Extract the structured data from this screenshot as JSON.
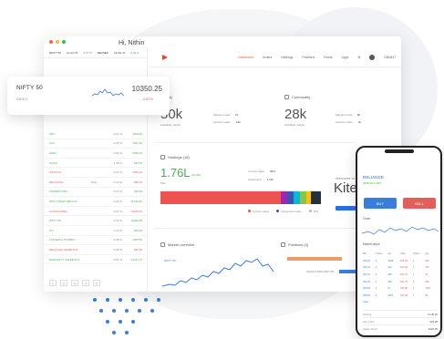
{
  "card": {
    "title": "NIFTY 50",
    "subtitle": "INDEX",
    "value": "10350.25",
    "change": "-3.57%"
  },
  "header": {
    "indices": [
      {
        "name": "NIFTY 50",
        "value": "10126.95",
        "change": "0.47 %"
      },
      {
        "name": "SENSEX",
        "value": "33399.40",
        "change": "0.40 %"
      }
    ]
  },
  "nav": {
    "items": [
      "Dashboard",
      "Orders",
      "Holdings",
      "Positions",
      "Funds",
      "Apps"
    ],
    "user": "DBA847"
  },
  "greeting": "Hi, Nithin",
  "equity": {
    "title": "Equity",
    "value": "50k",
    "sub": "Available margin",
    "rows": [
      {
        "k": "Margins used",
        "v": "10"
      },
      {
        "k": "Account value",
        "v": "10k"
      }
    ]
  },
  "commodity": {
    "title": "Commodity",
    "value": "28k",
    "sub": "Available margin",
    "rows": [
      {
        "k": "Margins used",
        "v": "8k"
      },
      {
        "k": "Account value",
        "v": "2k"
      }
    ]
  },
  "holdings": {
    "title": "Holdings (18)",
    "value": "1.76L",
    "pct": "32.29%",
    "sub": "P&L",
    "rows": [
      {
        "k": "Current value",
        "v": "89%"
      },
      {
        "k": "Investment",
        "v": "1.23L"
      }
    ],
    "legend": [
      "Current value",
      "Investment value",
      "P&L"
    ]
  },
  "market_overview": {
    "title": "Market overview",
    "series_label": "NIFTY 50"
  },
  "positions": {
    "title": "Positions (3)",
    "label": "SHIELD-1890 SEP PE"
  },
  "kite": {
    "welcome": "Welcome to",
    "name": "Kite"
  },
  "watchlist": [
    {
      "symbol": "INFY",
      "exch": "",
      "change": "0.21 %",
      "price": "1108.40",
      "dir": "up"
    },
    {
      "symbol": "ACC",
      "exch": "",
      "change": "0.25 %",
      "price": "1181.90",
      "dir": "up"
    },
    {
      "symbol": "HDFC",
      "exch": "",
      "change": "0.82 %",
      "price": "1833.00",
      "dir": "up"
    },
    {
      "symbol": "ONGC",
      "exch": "",
      "change": "1.48 %",
      "price": "183.60",
      "dir": "up"
    },
    {
      "symbol": "INFOSYS",
      "exch": "",
      "change": "0.22 %",
      "price": "1182.65",
      "dir": "down"
    },
    {
      "symbol": "RELIANCE",
      "exch": "BSE",
      "change": "0.12 %",
      "price": "995.00",
      "dir": "down"
    },
    {
      "symbol": "TATAMOTORS",
      "exch": "",
      "change": "0.24 %",
      "price": "418.45",
      "dir": "up"
    },
    {
      "symbol": "NIFTY BANK FEB FUT",
      "exch": "",
      "change": "0.26 %",
      "price": "26724.00",
      "dir": "up"
    },
    {
      "symbol": "GOLDGUINEA",
      "exch": "",
      "change": "0.07 %",
      "price": "24184.00",
      "dir": "down"
    },
    {
      "symbol": "NIFTY 50",
      "exch": "",
      "change": "0.42 %",
      "price": "10226.95",
      "dir": "up"
    },
    {
      "symbol": "ITC",
      "exch": "",
      "change": "0.14 %",
      "price": "268.35",
      "dir": "up"
    },
    {
      "symbol": "LARSEN & TOUBRO",
      "exch": "",
      "change": "0.09 %",
      "price": "1305.50",
      "dir": "up"
    },
    {
      "symbol": "RELIANCE 19FEB FUT",
      "exch": "",
      "change": "0.28 %",
      "price": "942.40",
      "dir": "down"
    },
    {
      "symbol": "BANKNIFTY 20FEB FUT",
      "exch": "",
      "change": "0.51 %",
      "price": "24722.75",
      "dir": "up"
    }
  ],
  "pager": [
    "1",
    "2",
    "3",
    "4",
    "5"
  ],
  "phone": {
    "symbol": "RELIANCE",
    "sub": "9308.25  0.36%",
    "buy": "BUY",
    "sell": "SELL",
    "chart_label": "Chart",
    "depth_label": "Market depth",
    "depth_head": [
      "Bid",
      "Orders",
      "Qty",
      "Offer",
      "Orders",
      "Qty"
    ],
    "depth_rows": [
      [
        "931.20",
        "2",
        "1234",
        "931.55",
        "1",
        "203"
      ],
      [
        "931.15",
        "1",
        "412",
        "931.60",
        "2",
        "781"
      ],
      [
        "931.10",
        "3",
        "905",
        "931.70",
        "1",
        "54"
      ],
      [
        "931.00",
        "2",
        "180",
        "931.75",
        "4",
        "336"
      ],
      [
        "930.95",
        "1",
        "67",
        "931.80",
        "2",
        "1220"
      ],
      [
        "930.90",
        "5",
        "2014",
        "931.85",
        "1",
        "88"
      ]
    ],
    "total_label": "Total",
    "footer": [
      {
        "k": "Volume",
        "v": "17,30,20"
      },
      {
        "k": "Avg. price",
        "v": "931.28"
      },
      {
        "k": "Upper circuit",
        "v": "1024.25"
      }
    ]
  },
  "colors": {
    "accent": "#ff5722",
    "buy": "#3b7ddd",
    "sell": "#e25f5b",
    "up": "#4caf50",
    "kite_logo": "#e5462d"
  }
}
